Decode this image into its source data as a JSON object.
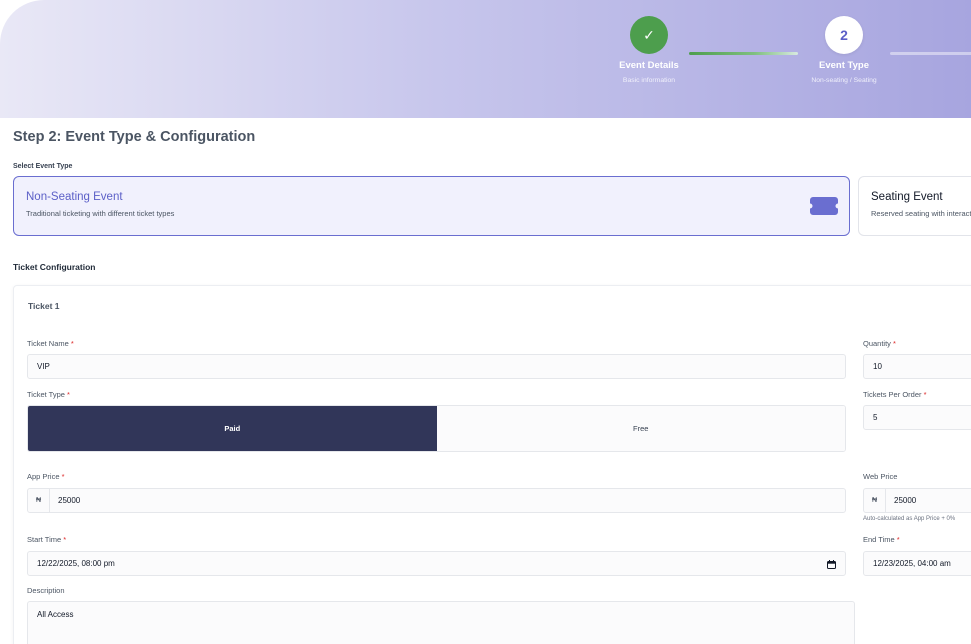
{
  "stepper": {
    "steps": [
      {
        "title": "Event Details",
        "subtitle": "Basic information",
        "marker": "✓",
        "state": "completed"
      },
      {
        "title": "Event Type",
        "subtitle": "Non-seating / Seating",
        "marker": "2",
        "state": "active"
      }
    ],
    "colors": {
      "completed": "#4d9e4d",
      "accent": "#5b5fc7"
    }
  },
  "page": {
    "title": "Step 2: Event Type & Configuration",
    "select_label": "Select Event Type"
  },
  "event_types": [
    {
      "title": "Non-Seating Event",
      "description": "Traditional ticketing with different ticket types",
      "selected": true,
      "icon": "ticket-icon"
    },
    {
      "title": "Seating Event",
      "description": "Reserved seating with interactive seat maps",
      "selected": false
    }
  ],
  "ticket_config": {
    "section_title": "Ticket Configuration",
    "ticket_heading": "Ticket 1",
    "required_mark": "*",
    "ticket_name": {
      "label": "Ticket Name",
      "value": "VIP"
    },
    "quantity": {
      "label": "Quantity",
      "value": "10"
    },
    "ticket_type": {
      "label": "Ticket Type",
      "options": [
        "Paid",
        "Free"
      ],
      "selected": "Paid"
    },
    "tickets_per_order": {
      "label": "Tickets Per Order",
      "value": "5"
    },
    "app_price": {
      "label": "App Price",
      "currency": "₦",
      "value": "25000"
    },
    "web_price": {
      "label": "Web Price",
      "currency": "₦",
      "value": "25000",
      "hint": "Auto-calculated as App Price + 0%"
    },
    "start_time": {
      "label": "Start Time",
      "value": "12/22/2025, 08:00 pm"
    },
    "end_time": {
      "label": "End Time",
      "value": "12/23/2025, 04:00 am"
    },
    "description": {
      "label": "Description",
      "value": "All Access"
    }
  }
}
